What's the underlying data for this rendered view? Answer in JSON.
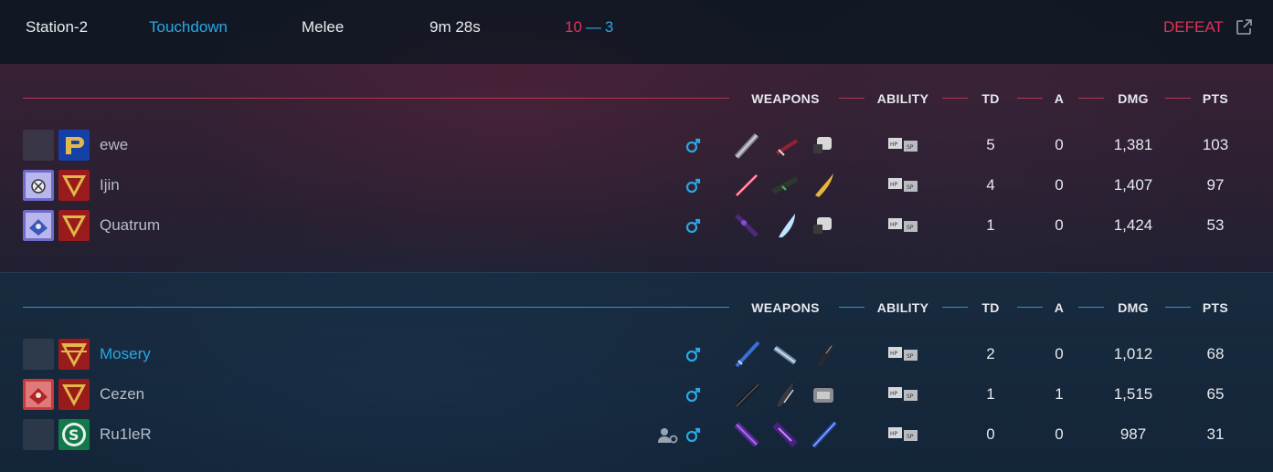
{
  "match": {
    "map": "Station-2",
    "mode": "Touchdown",
    "type": "Melee",
    "duration": "9m 28s",
    "score_red": "10",
    "score_separator": "—",
    "score_blue": "3",
    "result": "DEFEAT"
  },
  "columns": {
    "weapons": "WEAPONS",
    "ability": "ABILITY",
    "td": "TD",
    "a": "A",
    "dmg": "DMG",
    "pts": "PTS"
  },
  "colors": {
    "red": "#e0315a",
    "blue": "#2aa7e4"
  },
  "teams": [
    {
      "side": "red",
      "players": [
        {
          "name": "ewe",
          "td": "5",
          "a": "0",
          "dmg": "1,381",
          "pts": "103",
          "badge1": "empty",
          "badge2": "gold-p-emblem",
          "current_user": false,
          "friend_icon": false
        },
        {
          "name": "Ijin",
          "td": "4",
          "a": "0",
          "dmg": "1,407",
          "pts": "97",
          "badge1": "purple-medal",
          "badge2": "red-gold-chevron",
          "current_user": false,
          "friend_icon": false
        },
        {
          "name": "Quatrum",
          "td": "1",
          "a": "0",
          "dmg": "1,424",
          "pts": "53",
          "badge1": "purple-shield",
          "badge2": "red-gold-chevron",
          "current_user": false,
          "friend_icon": false
        }
      ]
    },
    {
      "side": "blue",
      "players": [
        {
          "name": "Mosery",
          "td": "2",
          "a": "0",
          "dmg": "1,012",
          "pts": "68",
          "badge1": "empty",
          "badge2": "red-gold-chevron",
          "current_user": true,
          "friend_icon": false
        },
        {
          "name": "Cezen",
          "td": "1",
          "a": "1",
          "dmg": "1,515",
          "pts": "65",
          "badge1": "red-shield",
          "badge2": "red-gold-chevron",
          "current_user": false,
          "friend_icon": false
        },
        {
          "name": "Ru1leR",
          "td": "0",
          "a": "0",
          "dmg": "987",
          "pts": "31",
          "badge1": "empty",
          "badge2": "green-s-emblem",
          "current_user": false,
          "friend_icon": true
        }
      ]
    }
  ],
  "icons": {
    "gender": "male-icon",
    "ability": "hp-sp-ability-icon",
    "friend": "friend-settings-icon",
    "external": "external-link-icon"
  }
}
